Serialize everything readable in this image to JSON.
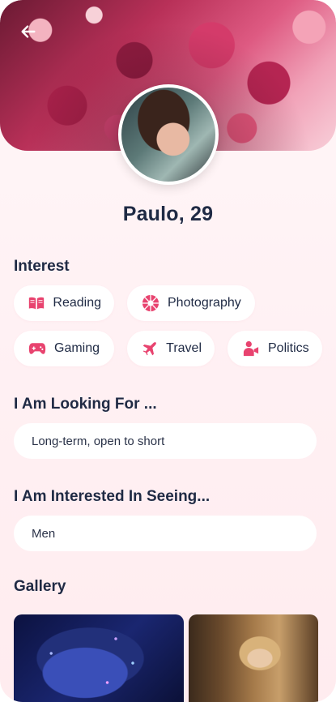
{
  "profile": {
    "name_age": "Paulo, 29"
  },
  "sections": {
    "interest": "Interest",
    "looking_for": "I Am Looking For ...",
    "interested_in": "I Am Interested In Seeing...",
    "gallery": "Gallery"
  },
  "interests": [
    {
      "label": "Reading",
      "icon": "book-icon"
    },
    {
      "label": "Photography",
      "icon": "camera-aperture-icon"
    },
    {
      "label": "Gaming",
      "icon": "gamepad-icon"
    },
    {
      "label": "Travel",
      "icon": "airplane-icon"
    },
    {
      "label": "Politics",
      "icon": "speaker-person-icon"
    }
  ],
  "looking_for_value": "Long-term, open to short",
  "interested_in_value": "Men",
  "colors": {
    "accent": "#e8436f",
    "text": "#1f2a44",
    "background": "#fff2f5",
    "chip": "#ffffff"
  }
}
